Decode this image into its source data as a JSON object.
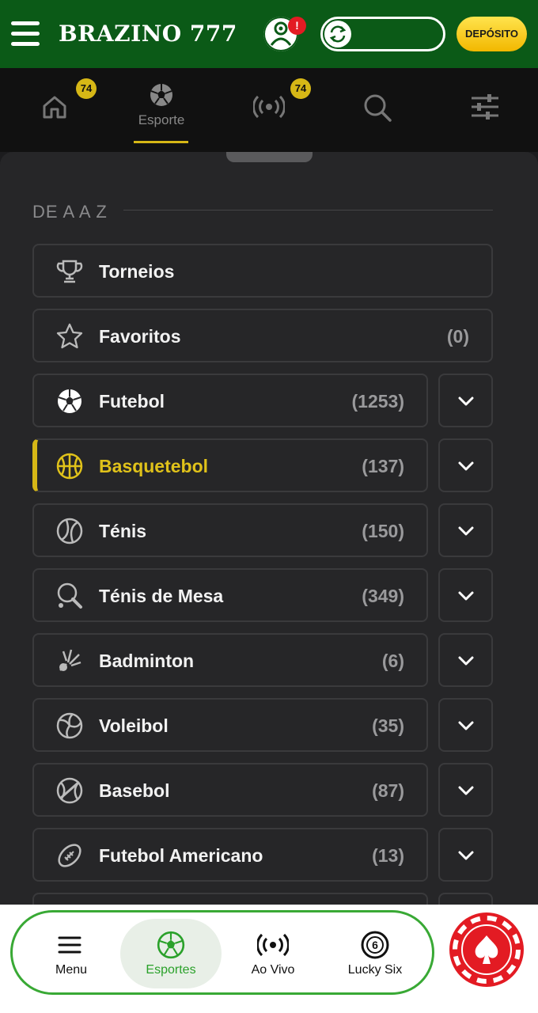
{
  "header": {
    "logo": "BRAZINO 777",
    "alert_badge": "!",
    "deposit_label": "DEPÓSITO",
    "colors": {
      "background": "#0b5a17",
      "deposit": "#f2c200",
      "alert": "#e31b23"
    }
  },
  "top_nav": {
    "home_badge": "74",
    "sport_label": "Esporte",
    "live_badge": "74"
  },
  "sheet": {
    "section_title": "DE A A Z",
    "rows": [
      {
        "icon": "trophy-icon",
        "label": "Torneios",
        "count": "",
        "expandable": false
      },
      {
        "icon": "star-icon",
        "label": "Favoritos",
        "count": "(0)",
        "expandable": false
      },
      {
        "icon": "soccer-ball-icon",
        "label": "Futebol",
        "count": "(1253)",
        "expandable": true
      },
      {
        "icon": "basketball-icon",
        "label": "Basquetebol",
        "count": "(137)",
        "expandable": true,
        "active": true
      },
      {
        "icon": "tennis-ball-icon",
        "label": "Ténis",
        "count": "(150)",
        "expandable": true
      },
      {
        "icon": "table-tennis-icon",
        "label": "Ténis de Mesa",
        "count": "(349)",
        "expandable": true
      },
      {
        "icon": "shuttlecock-icon",
        "label": "Badminton",
        "count": "(6)",
        "expandable": true
      },
      {
        "icon": "volleyball-icon",
        "label": "Voleibol",
        "count": "(35)",
        "expandable": true
      },
      {
        "icon": "baseball-icon",
        "label": "Basebol",
        "count": "(87)",
        "expandable": true
      },
      {
        "icon": "american-football-icon",
        "label": "Futebol Americano",
        "count": "(13)",
        "expandable": true
      }
    ],
    "active_color": "#d6b716"
  },
  "bottom_nav": {
    "items": [
      {
        "icon": "menu-icon",
        "label": "Menu"
      },
      {
        "icon": "soccer-ball-icon",
        "label": "Esportes",
        "active": true
      },
      {
        "icon": "live-broadcast-icon",
        "label": "Ao Vivo"
      },
      {
        "icon": "lucky-six-icon",
        "label": "Lucky Six"
      }
    ],
    "accent": "#39a935"
  }
}
